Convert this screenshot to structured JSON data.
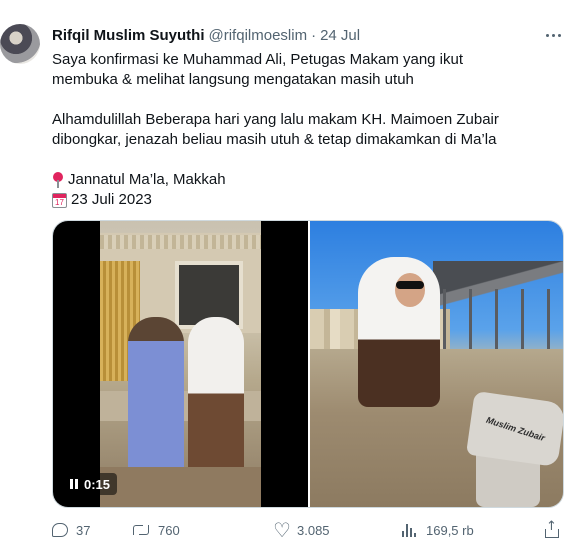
{
  "tweet": {
    "author": {
      "display_name": "Rifqil Muslim Suyuthi",
      "handle": "@rifqilmoeslim",
      "separator": "·",
      "time": "24 Jul"
    },
    "text_lines": [
      "Saya konfirmasi ke Muhammad Ali, Petugas Makam yang ikut",
      "membuka & melihat langsung mengatakan masih utuh",
      "Alhamdulillah Beberapa hari yang lalu makam KH. Maimoen Zubair",
      "dibongkar, jenazah beliau masih utuh & tetap dimakamkan di Ma’la"
    ],
    "location": "Jannatul Ma’la, Makkah",
    "date_line": "23 Juli 2023",
    "calendar_glyph": "17",
    "media": {
      "video_time": "0:15",
      "stone_inscription": "Muslim Zubair"
    },
    "actions": {
      "replies": "37",
      "retweets": "760",
      "likes": "3.085",
      "views": "169,5 rb"
    }
  },
  "icons": [
    "more-icon",
    "pin-icon",
    "calendar-icon",
    "pause-icon",
    "reply-icon",
    "retweet-icon",
    "heart-icon",
    "views-icon",
    "share-icon"
  ]
}
